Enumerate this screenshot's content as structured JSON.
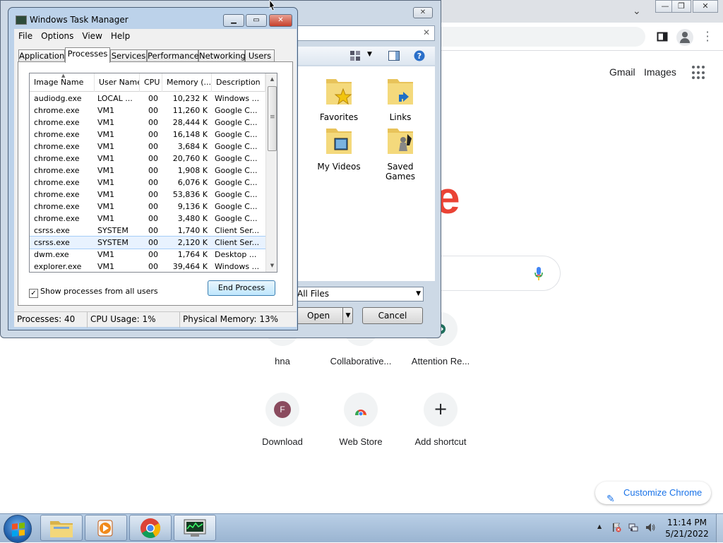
{
  "chrome": {
    "gmail": "Gmail",
    "images": "Images",
    "logo_fragment": "e",
    "shortcuts_row1": [
      "hna",
      "Collaborative...",
      "Attention Re..."
    ],
    "shortcuts_row2": [
      {
        "label": "Download",
        "letter": "F"
      },
      {
        "label": "Web Store",
        "letter": ""
      },
      {
        "label": "Add shortcut",
        "letter": "+"
      }
    ],
    "customize": "Customize Chrome"
  },
  "dialog": {
    "folders": [
      "Favorites",
      "Links",
      "My Videos",
      "Saved Games"
    ],
    "partial_text": "s",
    "filetype": "All Files",
    "open": "Open",
    "cancel": "Cancel"
  },
  "taskmgr": {
    "title": "Windows Task Manager",
    "menu": [
      "File",
      "Options",
      "View",
      "Help"
    ],
    "tabs": [
      "Applications",
      "Processes",
      "Services",
      "Performance",
      "Networking",
      "Users"
    ],
    "active_tab": "Processes",
    "columns": [
      "Image Name",
      "User Name",
      "CPU",
      "Memory (...",
      "Description"
    ],
    "rows": [
      [
        "audiodg.exe",
        "LOCAL ...",
        "00",
        "10,232 K",
        "Windows ..."
      ],
      [
        "chrome.exe",
        "VM1",
        "00",
        "11,260 K",
        "Google C..."
      ],
      [
        "chrome.exe",
        "VM1",
        "00",
        "28,444 K",
        "Google C..."
      ],
      [
        "chrome.exe",
        "VM1",
        "00",
        "16,148 K",
        "Google C..."
      ],
      [
        "chrome.exe",
        "VM1",
        "00",
        "3,684 K",
        "Google C..."
      ],
      [
        "chrome.exe",
        "VM1",
        "00",
        "20,760 K",
        "Google C..."
      ],
      [
        "chrome.exe",
        "VM1",
        "00",
        "1,908 K",
        "Google C..."
      ],
      [
        "chrome.exe",
        "VM1",
        "00",
        "6,076 K",
        "Google C..."
      ],
      [
        "chrome.exe",
        "VM1",
        "00",
        "53,836 K",
        "Google C..."
      ],
      [
        "chrome.exe",
        "VM1",
        "00",
        "9,136 K",
        "Google C..."
      ],
      [
        "chrome.exe",
        "VM1",
        "00",
        "3,480 K",
        "Google C..."
      ],
      [
        "csrss.exe",
        "SYSTEM",
        "00",
        "1,740 K",
        "Client Ser..."
      ],
      [
        "csrss.exe",
        "SYSTEM",
        "00",
        "2,120 K",
        "Client Ser..."
      ],
      [
        "dwm.exe",
        "VM1",
        "00",
        "1,764 K",
        "Desktop ..."
      ],
      [
        "explorer.exe",
        "VM1",
        "00",
        "39,464 K",
        "Windows ..."
      ]
    ],
    "selected_row": 12,
    "show_all_label": "Show processes from all users",
    "show_all_checked": true,
    "end_process": "End Process",
    "status": {
      "processes": "Processes: 40",
      "cpu": "CPU Usage: 1%",
      "memory": "Physical Memory: 13%"
    }
  },
  "taskbar": {
    "time": "11:14 PM",
    "date": "5/21/2022"
  },
  "colors": {
    "chrome_blue": "#1a73e8",
    "google_red": "#ea4335",
    "selection": "#e8f2fe",
    "close_red": "#d9443a"
  }
}
